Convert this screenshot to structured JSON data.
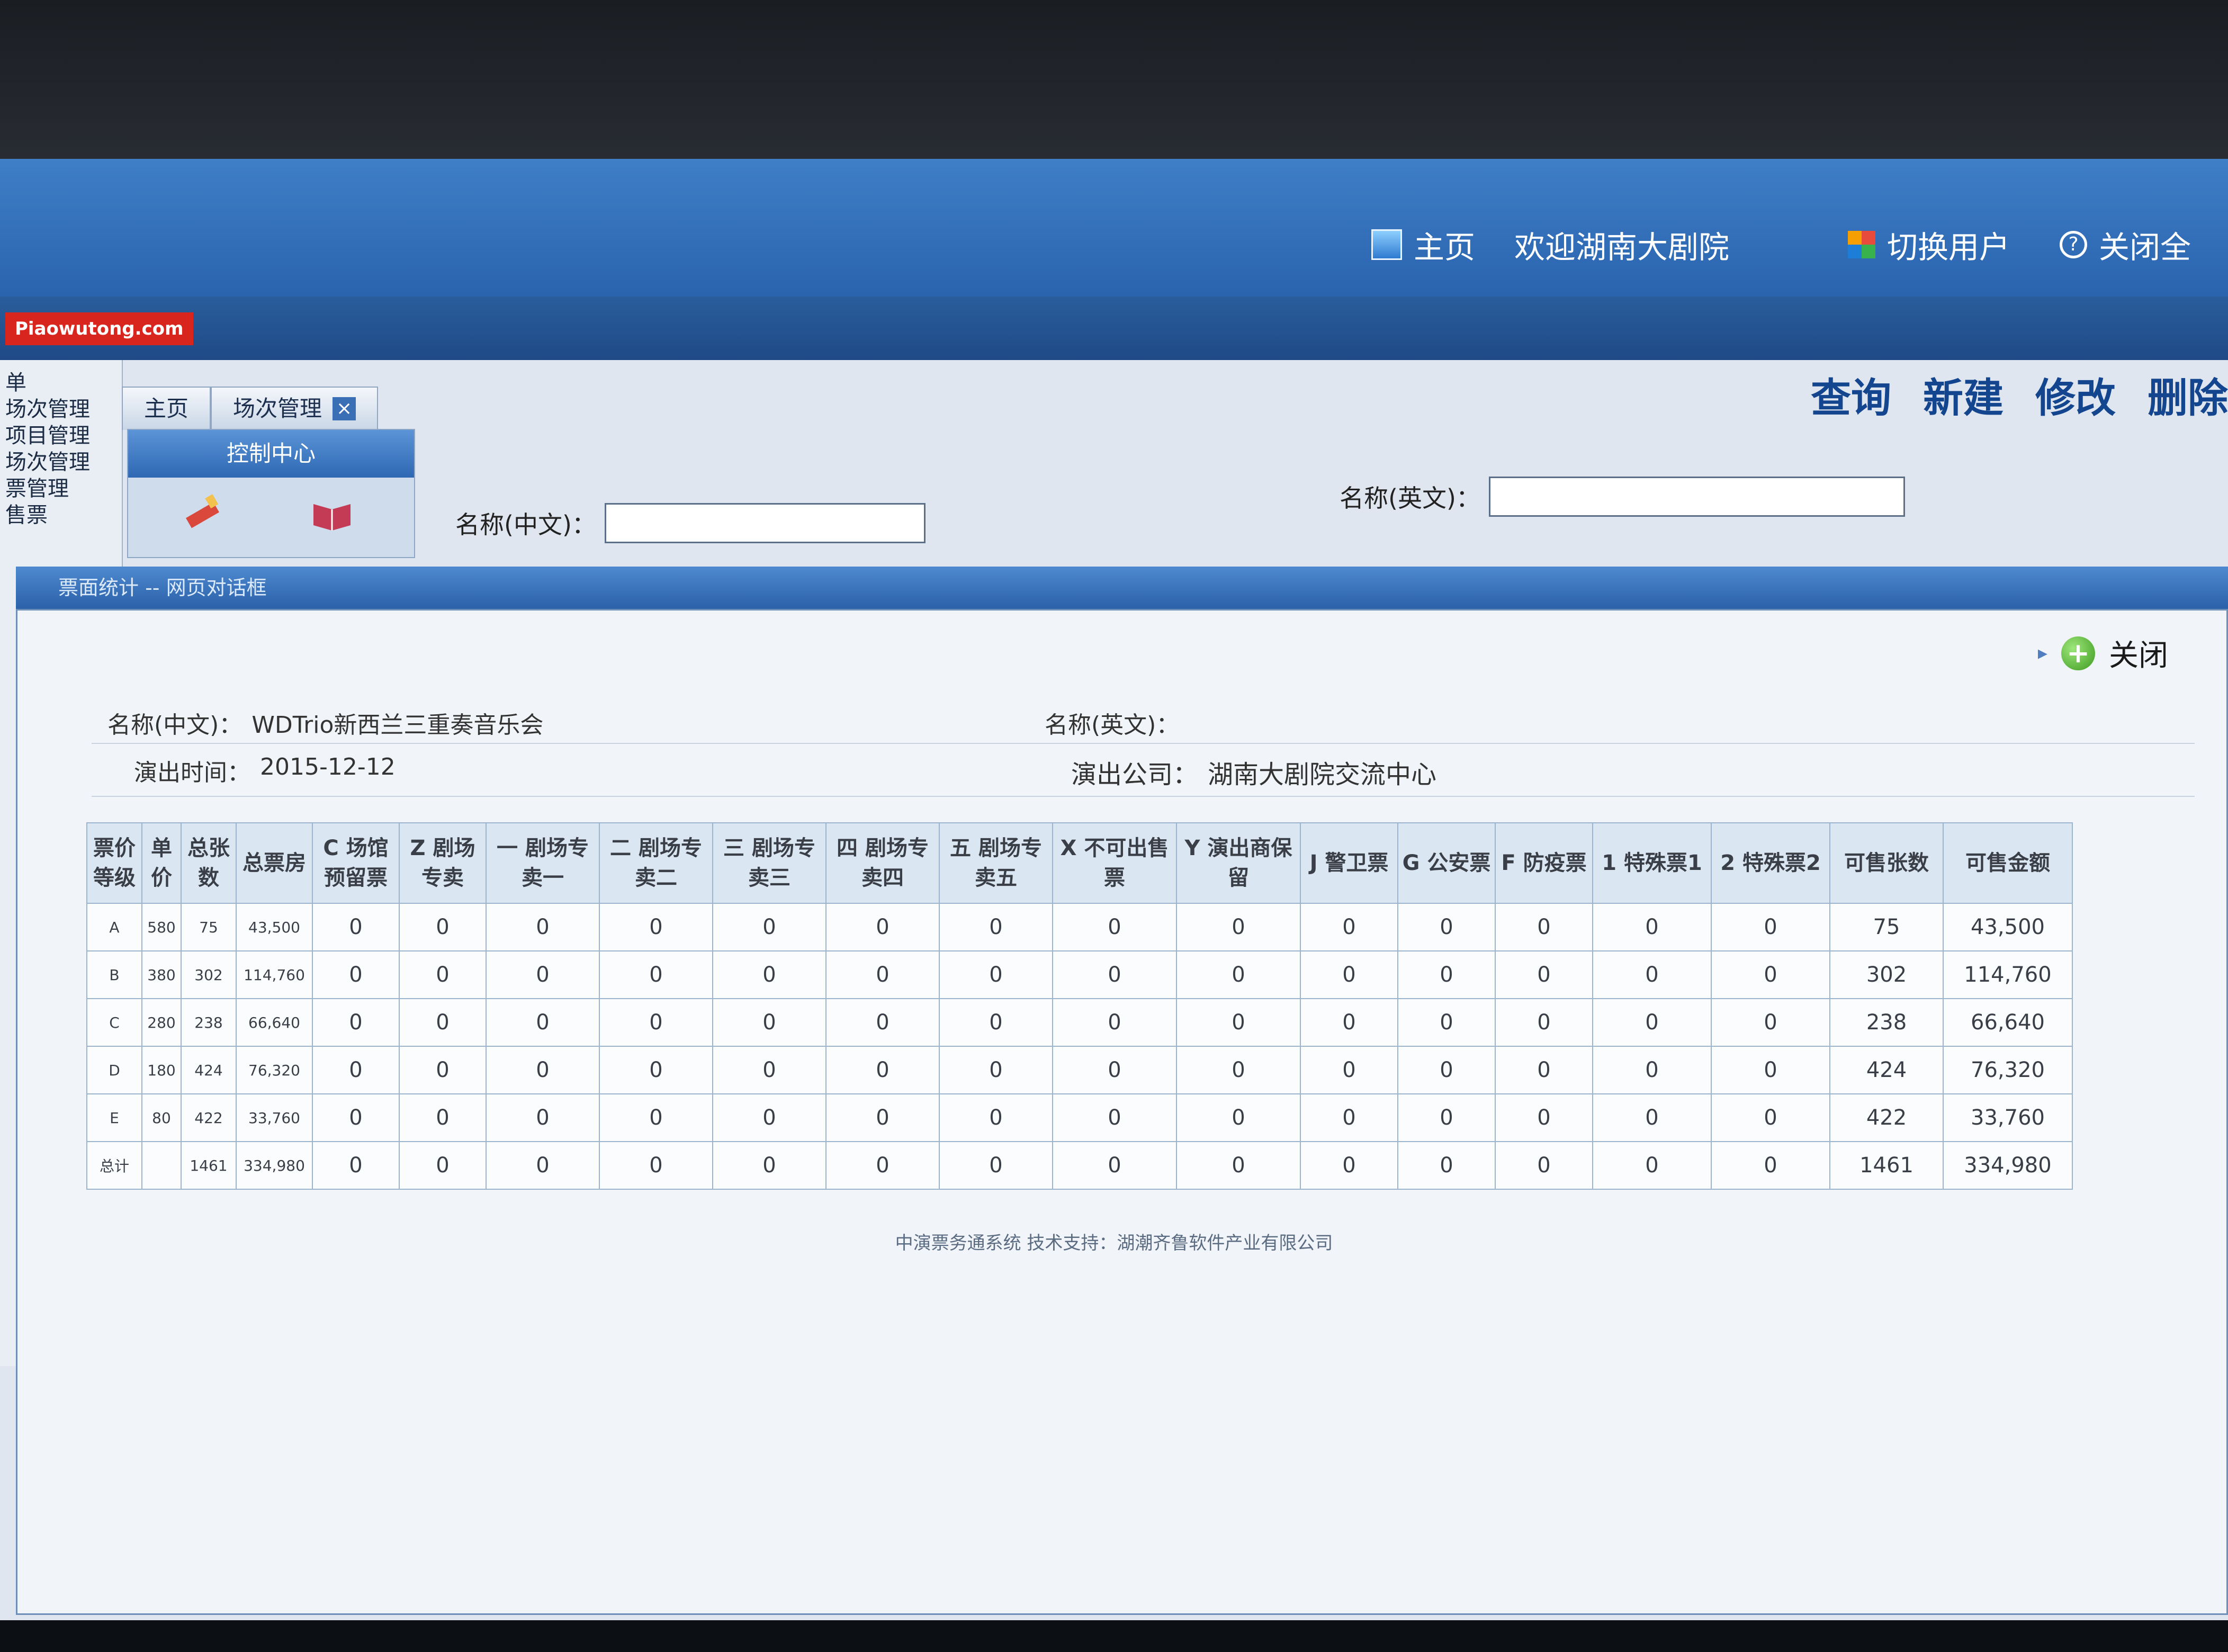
{
  "topbar": {
    "home": "主页",
    "welcome": "欢迎湖南大剧院",
    "switch_user": "切换用户",
    "close_all": "关闭全"
  },
  "logo": "Piaowutong.com",
  "leftnav": [
    "单",
    "场次管理",
    "项目管理",
    "场次管理",
    "票管理",
    "售票"
  ],
  "tabs": [
    "主页",
    "场次管理"
  ],
  "control_center": "控制中心",
  "actions": [
    "查询",
    "新建",
    "修改",
    "删除"
  ],
  "search": {
    "name_cn_label": "名称(中文)：",
    "name_en_label": "名称(英文)："
  },
  "dialog": {
    "title": "票面统计 -- 网页对话框",
    "close_label": "关闭",
    "name_cn_label": "名称(中文)：",
    "name_cn_value": "WDTrio新西兰三重奏音乐会",
    "name_en_label": "名称(英文)：",
    "name_en_value": "",
    "date_label": "演出时间：",
    "date_value": "2015-12-12",
    "company_label": "演出公司：",
    "company_value": "湖南大剧院交流中心"
  },
  "table": {
    "headers": [
      "票价等级",
      "单价",
      "总张数",
      "总票房",
      "C 场馆预留票",
      "Z 剧场专卖",
      "一 剧场专卖一",
      "二 剧场专卖二",
      "三 剧场专卖三",
      "四 剧场专卖四",
      "五 剧场专卖五",
      "X 不可出售票",
      "Y 演出商保留",
      "J 警卫票",
      "G 公安票",
      "F 防疫票",
      "1 特殊票1",
      "2 特殊票2",
      "可售张数",
      "可售金额"
    ],
    "rows": [
      [
        "A",
        "580",
        "75",
        "43,500",
        "0",
        "0",
        "0",
        "0",
        "0",
        "0",
        "0",
        "0",
        "0",
        "0",
        "0",
        "0",
        "0",
        "0",
        "75",
        "43,500"
      ],
      [
        "B",
        "380",
        "302",
        "114,760",
        "0",
        "0",
        "0",
        "0",
        "0",
        "0",
        "0",
        "0",
        "0",
        "0",
        "0",
        "0",
        "0",
        "0",
        "302",
        "114,760"
      ],
      [
        "C",
        "280",
        "238",
        "66,640",
        "0",
        "0",
        "0",
        "0",
        "0",
        "0",
        "0",
        "0",
        "0",
        "0",
        "0",
        "0",
        "0",
        "0",
        "238",
        "66,640"
      ],
      [
        "D",
        "180",
        "424",
        "76,320",
        "0",
        "0",
        "0",
        "0",
        "0",
        "0",
        "0",
        "0",
        "0",
        "0",
        "0",
        "0",
        "0",
        "0",
        "424",
        "76,320"
      ],
      [
        "E",
        "80",
        "422",
        "33,760",
        "0",
        "0",
        "0",
        "0",
        "0",
        "0",
        "0",
        "0",
        "0",
        "0",
        "0",
        "0",
        "0",
        "0",
        "422",
        "33,760"
      ],
      [
        "总计",
        "",
        "1461",
        "334,980",
        "0",
        "0",
        "0",
        "0",
        "0",
        "0",
        "0",
        "0",
        "0",
        "0",
        "0",
        "0",
        "0",
        "0",
        "1461",
        "334,980"
      ]
    ]
  },
  "footer": "中演票务通系统 技术支持：湖潮齐鲁软件产业有限公司",
  "right_cut": [
    "湖",
    "湖",
    "湖",
    "湖",
    "湖"
  ]
}
